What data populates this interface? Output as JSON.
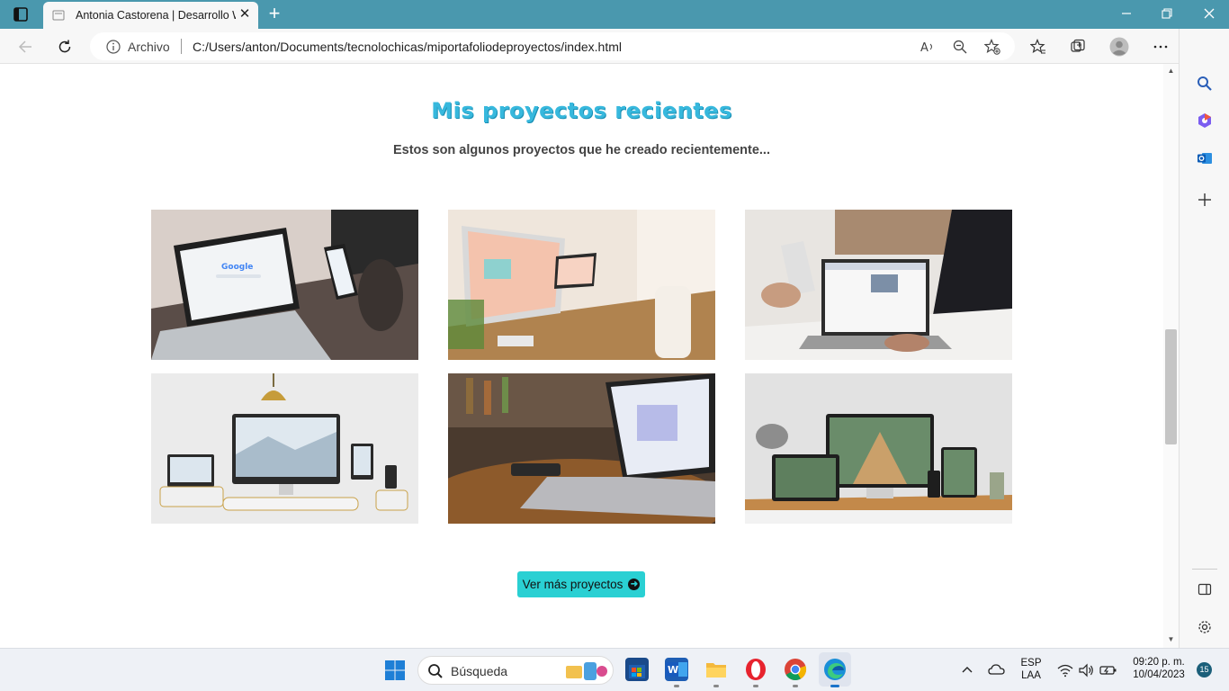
{
  "browser": {
    "tab_title": "Antonia Castorena | Desarrollo W",
    "address_label": "Archivo",
    "url": "C:/Users/anton/Documents/tecnolochicas/miportafoliodeproyectos/index.html",
    "new_tab_symbol": "+",
    "tab_close_symbol": "✕"
  },
  "page": {
    "title": "Mis proyectos recientes",
    "subtitle": "Estos son algunos proyectos que he creado recientemente...",
    "more_button": "Ver más proyectos",
    "projects": [
      {
        "icon": "laptop-search-photo"
      },
      {
        "icon": "desktop-design-photo"
      },
      {
        "icon": "phone-laptop-photo"
      },
      {
        "icon": "responsive-devices-photo"
      },
      {
        "icon": "laptop-table-photo"
      },
      {
        "icon": "architecture-devices-photo"
      }
    ]
  },
  "taskbar": {
    "search_placeholder": "Búsqueda",
    "lang_1": "ESP",
    "lang_2": "LAA",
    "time": "09:20 p. m.",
    "date": "10/04/2023",
    "notifications": "15"
  },
  "colors": {
    "titlebar": "#4a98ae",
    "accent_title": "#37b8dd",
    "button": "#2ad0d3"
  }
}
